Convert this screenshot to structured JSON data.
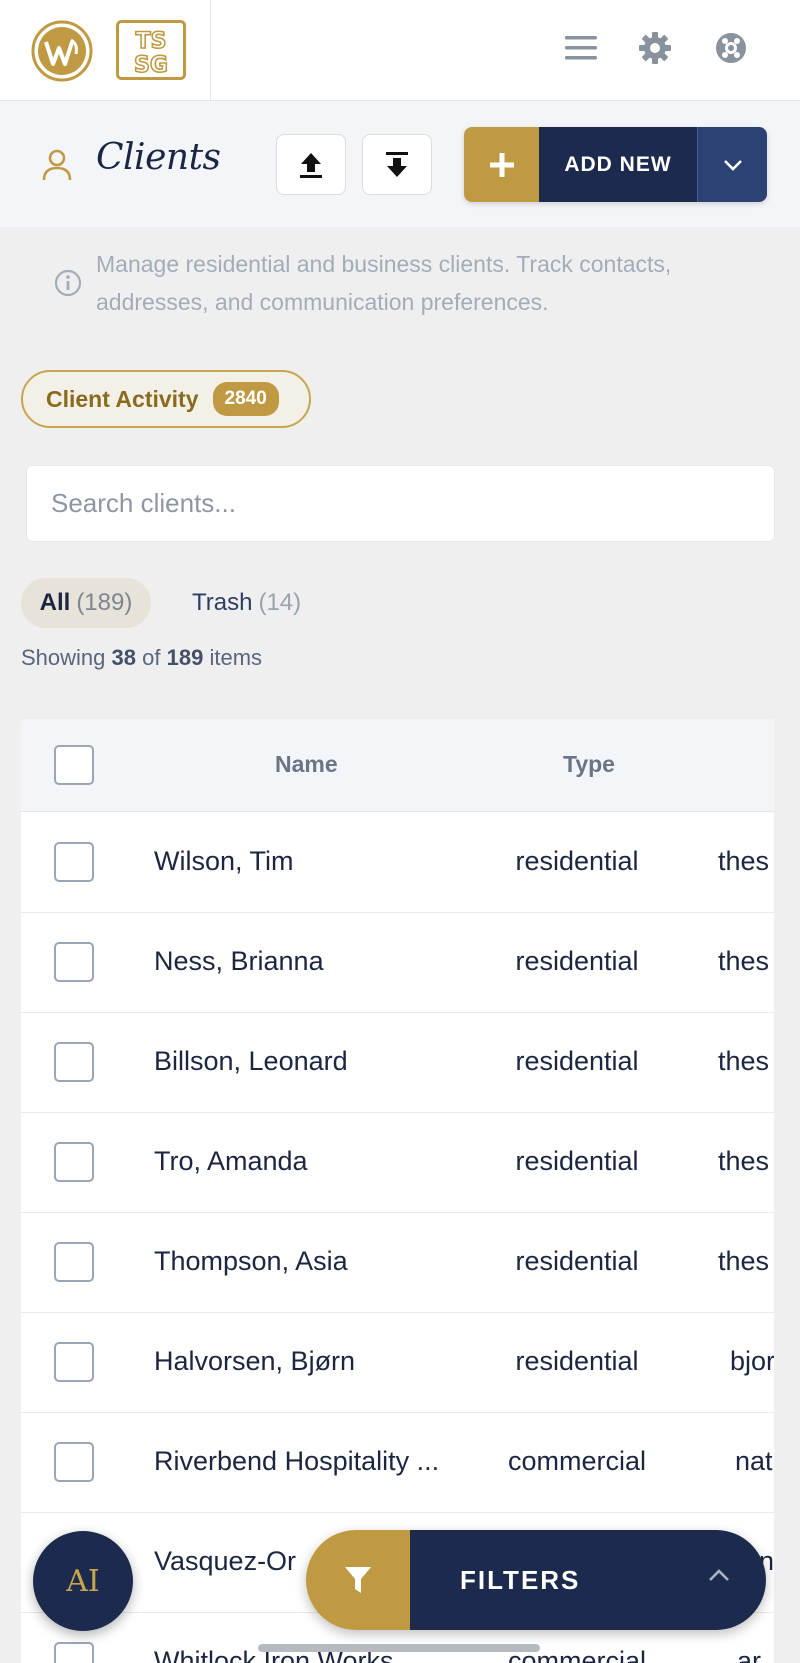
{
  "header": {
    "title": "Clients",
    "logo_text_top": "TS",
    "logo_text_bottom": "SG"
  },
  "actions": {
    "add_new_label": "ADD NEW"
  },
  "info": {
    "text": "Manage residential and business clients. Track contacts, addresses, and communication preferences."
  },
  "activity": {
    "label": "Client Activity",
    "count": "2840"
  },
  "search": {
    "placeholder": "Search clients..."
  },
  "tabs": [
    {
      "label": "All",
      "count": "(189)"
    },
    {
      "label": "Trash",
      "count": "(14)"
    }
  ],
  "summary": {
    "prefix": "Showing",
    "shown": "38",
    "of": "of",
    "total": "189",
    "suffix": "items"
  },
  "table": {
    "columns": [
      "Name",
      "Type"
    ],
    "rows": [
      {
        "name": "Wilson, Tim",
        "type": "residential",
        "extra": "thes"
      },
      {
        "name": "Ness, Brianna",
        "type": "residential",
        "extra": "thes"
      },
      {
        "name": "Billson, Leonard",
        "type": "residential",
        "extra": "thes"
      },
      {
        "name": "Tro, Amanda",
        "type": "residential",
        "extra": "thes"
      },
      {
        "name": "Thompson, Asia",
        "type": "residential",
        "extra": "thes"
      },
      {
        "name": "Halvorsen, Bjørn",
        "type": "residential",
        "extra": "bjor"
      },
      {
        "name": "Riverbend Hospitality ...",
        "type": "commercial",
        "extra": "nat"
      },
      {
        "name": "Vasquez-Or",
        "type": "",
        "extra": "n"
      },
      {
        "name": "Whitlock Iron Works",
        "type": "commercial",
        "extra": "ar"
      }
    ]
  },
  "floating": {
    "ai_label": "AI",
    "filters_label": "FILTERS"
  },
  "colors": {
    "navy": "#1b2a4d",
    "gold": "#c09a43",
    "background": "#efefef"
  },
  "icons": [
    "wordpress-logo",
    "tssg-logo",
    "menu-icon",
    "gear-icon",
    "support-icon",
    "person-icon",
    "upload-icon",
    "download-icon",
    "plus-icon",
    "chevron-down-icon",
    "info-icon",
    "filter-icon",
    "chevron-up-icon"
  ]
}
